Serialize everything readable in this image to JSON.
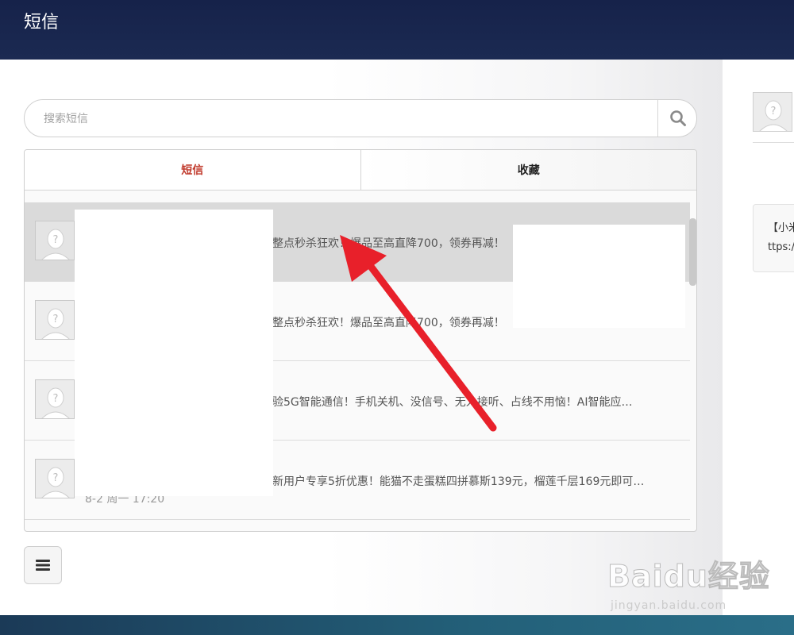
{
  "header": {
    "title": "短信"
  },
  "search": {
    "placeholder": "搜索短信"
  },
  "tabs": [
    {
      "label": "短信",
      "active": true
    },
    {
      "label": "收藏",
      "active": false
    }
  ],
  "messages": [
    {
      "snippet": "整点秒杀狂欢！爆品至高直降700，领券再减！",
      "time": "",
      "selected": true
    },
    {
      "snippet": "整点秒杀狂欢！爆品至高直降700，领券再减！",
      "time": "",
      "selected": false
    },
    {
      "snippet": "验5G智能通信！手机关机、没信号、无人接听、占线不用恼！AI智能应…",
      "time": "",
      "selected": false
    },
    {
      "snippet": "新用户专享5折优惠！能猫不走蛋糕四拼慕斯139元，榴莲千层169元即可…",
      "time": "8-2 周一 17:20",
      "selected": false
    }
  ],
  "right_pane": {
    "bubble_line1": "【小米",
    "bubble_line2": "ttps://"
  },
  "watermark": {
    "brand": "Baidu经验",
    "sub": "jingyan.baidu.com"
  },
  "colors": {
    "header": "#16224a",
    "active_tab": "#c0392b",
    "annotation_arrow": "#e8202a",
    "footer": "#236079"
  },
  "icons": {
    "search": "search-icon",
    "menu": "hamburger-menu-icon",
    "avatar": "default-avatar-icon"
  }
}
